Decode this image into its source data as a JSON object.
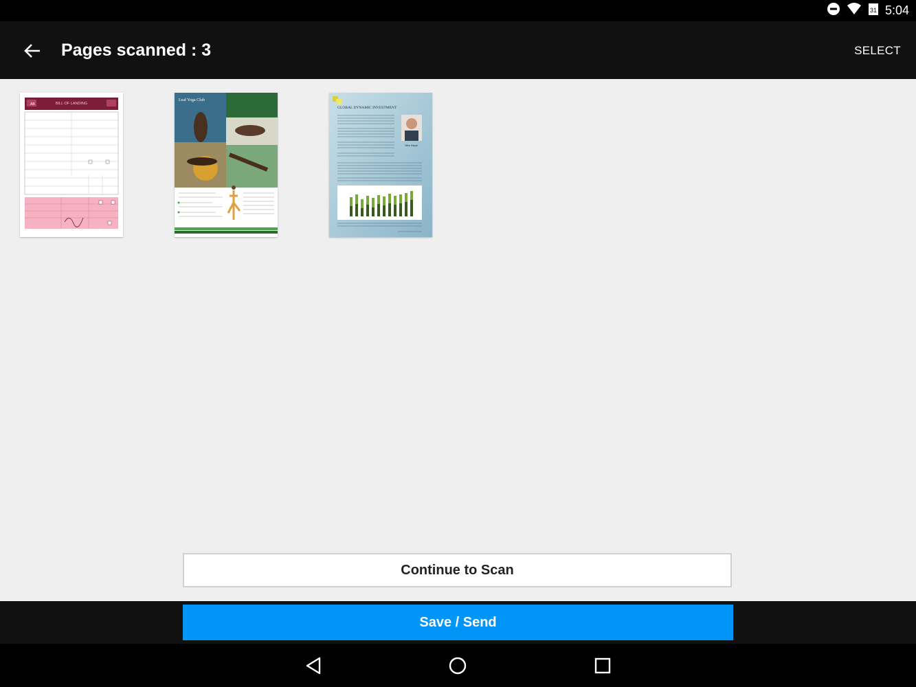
{
  "status_bar": {
    "time": "5:04",
    "icons": [
      "do-not-disturb-icon",
      "wifi-icon",
      "calendar-notification-icon"
    ],
    "calendar_day": "31"
  },
  "app_bar": {
    "title": "Pages scanned : 3",
    "select_label": "SELECT",
    "back_icon": "arrow-left-icon"
  },
  "pages": [
    {
      "name": "page-1",
      "heading": "BILL OF LANDING",
      "logo": "AB",
      "accent": "#8b2040",
      "pink": "#f4a4b4"
    },
    {
      "name": "page-2",
      "heading": "Leaf Yoga Club",
      "accent": "#4aa64a"
    },
    {
      "name": "page-3",
      "heading": "GLOBAL DYNAMIC INVESTMENT",
      "caption": "Mike Harper",
      "accent": "#a8c8d8"
    }
  ],
  "buttons": {
    "continue_label": "Continue to Scan",
    "save_label": "Save / Send"
  },
  "colors": {
    "primary": "#0195f8",
    "app_bar": "#111111",
    "background": "#efefef"
  },
  "nav_bar": {
    "icons": [
      "back-triangle-icon",
      "home-circle-icon",
      "recents-square-icon"
    ]
  }
}
